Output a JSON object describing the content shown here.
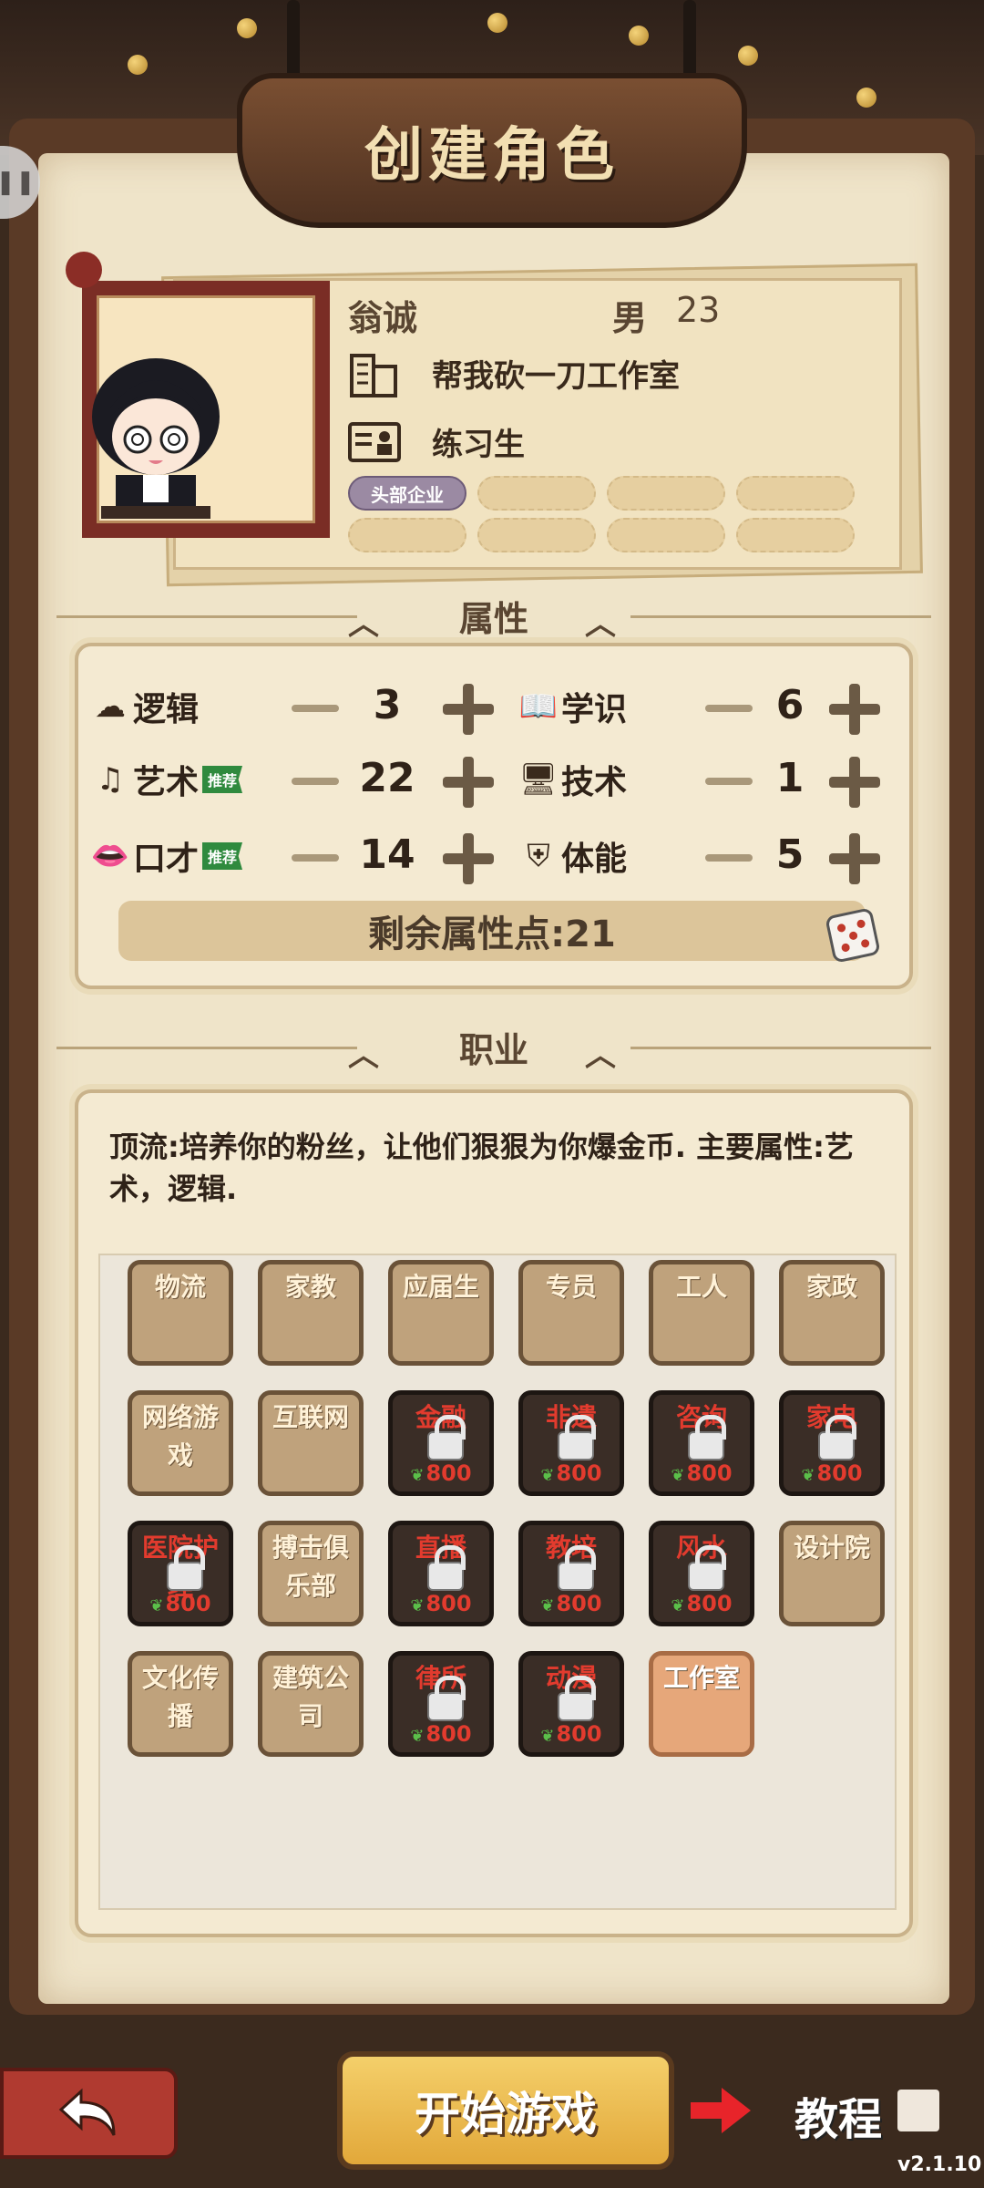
{
  "header": {
    "title": "创建角色"
  },
  "profile": {
    "name": "翁诚",
    "gender": "男",
    "age": "23",
    "company": "帮我砍一刀工作室",
    "position": "练习生",
    "tags": [
      "头部企业"
    ]
  },
  "sections": {
    "attributes": "属性",
    "jobs": "职业"
  },
  "attributes": {
    "recommend_label": "推荐",
    "items": [
      {
        "name": "逻辑",
        "value": "3",
        "icon": "brain-icon",
        "recommended": false
      },
      {
        "name": "学识",
        "value": "6",
        "icon": "book-icon",
        "recommended": false
      },
      {
        "name": "艺术",
        "value": "22",
        "icon": "music-note-icon",
        "recommended": true
      },
      {
        "name": "技术",
        "value": "1",
        "icon": "monitor-icon",
        "recommended": false
      },
      {
        "name": "口才",
        "value": "14",
        "icon": "lips-icon",
        "recommended": true
      },
      {
        "name": "体能",
        "value": "5",
        "icon": "shield-bolt-icon",
        "recommended": false
      }
    ],
    "remaining_label": "剩余属性点:21"
  },
  "job_desc": "顶流:培养你的粉丝，让他们狠狠为你爆金币. 主要属性:艺术，逻辑.",
  "jobs": [
    {
      "label": "物流",
      "state": "normal"
    },
    {
      "label": "家教",
      "state": "normal"
    },
    {
      "label": "应届生",
      "state": "normal"
    },
    {
      "label": "专员",
      "state": "normal"
    },
    {
      "label": "工人",
      "state": "normal"
    },
    {
      "label": "家政",
      "state": "normal"
    },
    {
      "label": "网络游戏",
      "state": "normal"
    },
    {
      "label": "互联网",
      "state": "normal"
    },
    {
      "label": "金融",
      "state": "locked",
      "price": "800"
    },
    {
      "label": "非遗",
      "state": "locked",
      "price": "800"
    },
    {
      "label": "咨询",
      "state": "locked",
      "price": "800"
    },
    {
      "label": "家电",
      "state": "locked",
      "price": "800"
    },
    {
      "label": "医院护理",
      "state": "locked",
      "price": "800"
    },
    {
      "label": "搏击俱乐部",
      "state": "normal"
    },
    {
      "label": "直播",
      "state": "locked",
      "price": "800"
    },
    {
      "label": "教培",
      "state": "locked",
      "price": "800"
    },
    {
      "label": "风水",
      "state": "locked",
      "price": "800"
    },
    {
      "label": "设计院",
      "state": "normal"
    },
    {
      "label": "文化传播",
      "state": "normal"
    },
    {
      "label": "建筑公司",
      "state": "normal"
    },
    {
      "label": "律所",
      "state": "locked",
      "price": "800"
    },
    {
      "label": "动漫",
      "state": "locked",
      "price": "800"
    },
    {
      "label": "工作室",
      "state": "selected"
    }
  ],
  "footer": {
    "start_label": "开始游戏",
    "tutorial_label": "教程",
    "version": "v2.1.10"
  },
  "colors": {
    "locked_text": "#e23b2e",
    "selected_job": "#e6a77a",
    "start_button": "#f4cf6a"
  }
}
